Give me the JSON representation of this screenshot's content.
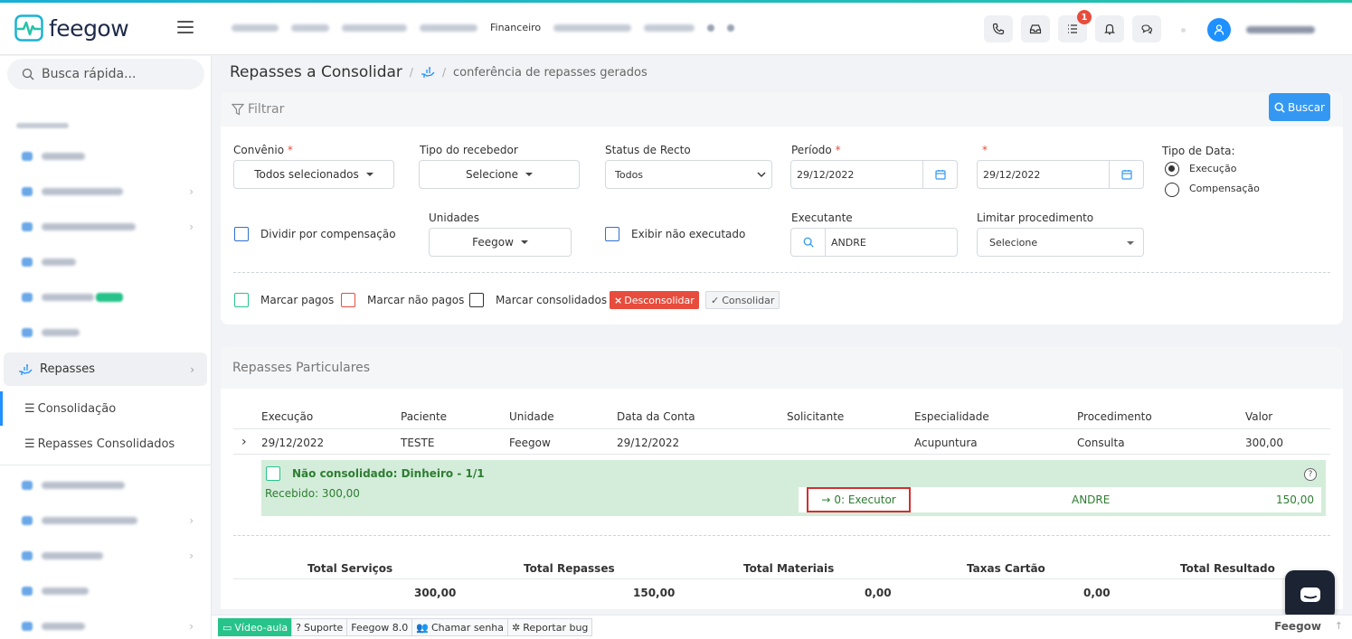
{
  "app": {
    "logo_text": "feegow"
  },
  "topnav": {
    "financeiro": "Financeiro"
  },
  "notifications": {
    "badge": "1"
  },
  "sidebar": {
    "search_placeholder": "Busca rápida...",
    "active_item": "Repasses",
    "sub_items": [
      {
        "label": "Consolidação"
      },
      {
        "label": "Repasses Consolidados"
      }
    ]
  },
  "breadcrumb": {
    "title": "Repasses a Consolidar",
    "crumb": "conferência de repasses gerados"
  },
  "filter": {
    "title": "Filtrar",
    "buscar_label": "Buscar",
    "convenio": {
      "label": "Convênio",
      "required": "*",
      "value": "Todos selecionados"
    },
    "tipo_recebedor": {
      "label": "Tipo do recebedor",
      "value": "Selecione"
    },
    "status_recto": {
      "label": "Status de Recto",
      "value": "Todos"
    },
    "periodo": {
      "label": "Período",
      "required": "*",
      "from": "29/12/2022",
      "to_required": "*",
      "to": "29/12/2022"
    },
    "tipo_data": {
      "label": "Tipo de Data:",
      "options": [
        "Execução",
        "Compensação"
      ],
      "selected": "Execução"
    },
    "dividir_label": "Dividir por compensação",
    "unidades": {
      "label": "Unidades",
      "value": "Feegow"
    },
    "exibir_label": "Exibir não executado",
    "executante": {
      "label": "Executante",
      "value": "ANDRE"
    },
    "limitar": {
      "label": "Limitar procedimento",
      "value": "Selecione"
    },
    "marcar_pagos": "Marcar pagos",
    "marcar_nao_pagos": "Marcar não pagos",
    "marcar_consolidados": "Marcar consolidados",
    "desconsolidar": "Desconsolidar",
    "consolidar": "Consolidar"
  },
  "repasses": {
    "title": "Repasses Particulares",
    "headers": [
      "Execução",
      "Paciente",
      "Unidade",
      "Data da Conta",
      "Solicitante",
      "Especialidade",
      "Procedimento",
      "Valor"
    ],
    "row": [
      "29/12/2022",
      "TESTE",
      "Feegow",
      "29/12/2022",
      "",
      "Acupuntura",
      "Consulta",
      "300,00"
    ],
    "detail": {
      "title": "Não consolidado: Dinheiro - 1/1",
      "recebido": "Recebido: 300,00",
      "executor": "0: Executor",
      "name": "ANDRE",
      "value": "150,00"
    },
    "totals_headers": [
      "Total Serviços",
      "Total Repasses",
      "Total Materiais",
      "Taxas Cartão",
      "Total Resultado"
    ],
    "totals_values": [
      "300,00",
      "150,00",
      "0,00",
      "0,00"
    ]
  },
  "footer": {
    "video": "Vídeo-aula",
    "suporte": "Suporte",
    "version": "Feegow 8.0",
    "chamar": "Chamar senha",
    "reportar": "Reportar bug",
    "brand": "Feegow"
  },
  "colors": {
    "accent": "#3498f2",
    "danger": "#e74c3c",
    "success": "#27c38a",
    "consolidated_bg": "#d4edda"
  }
}
